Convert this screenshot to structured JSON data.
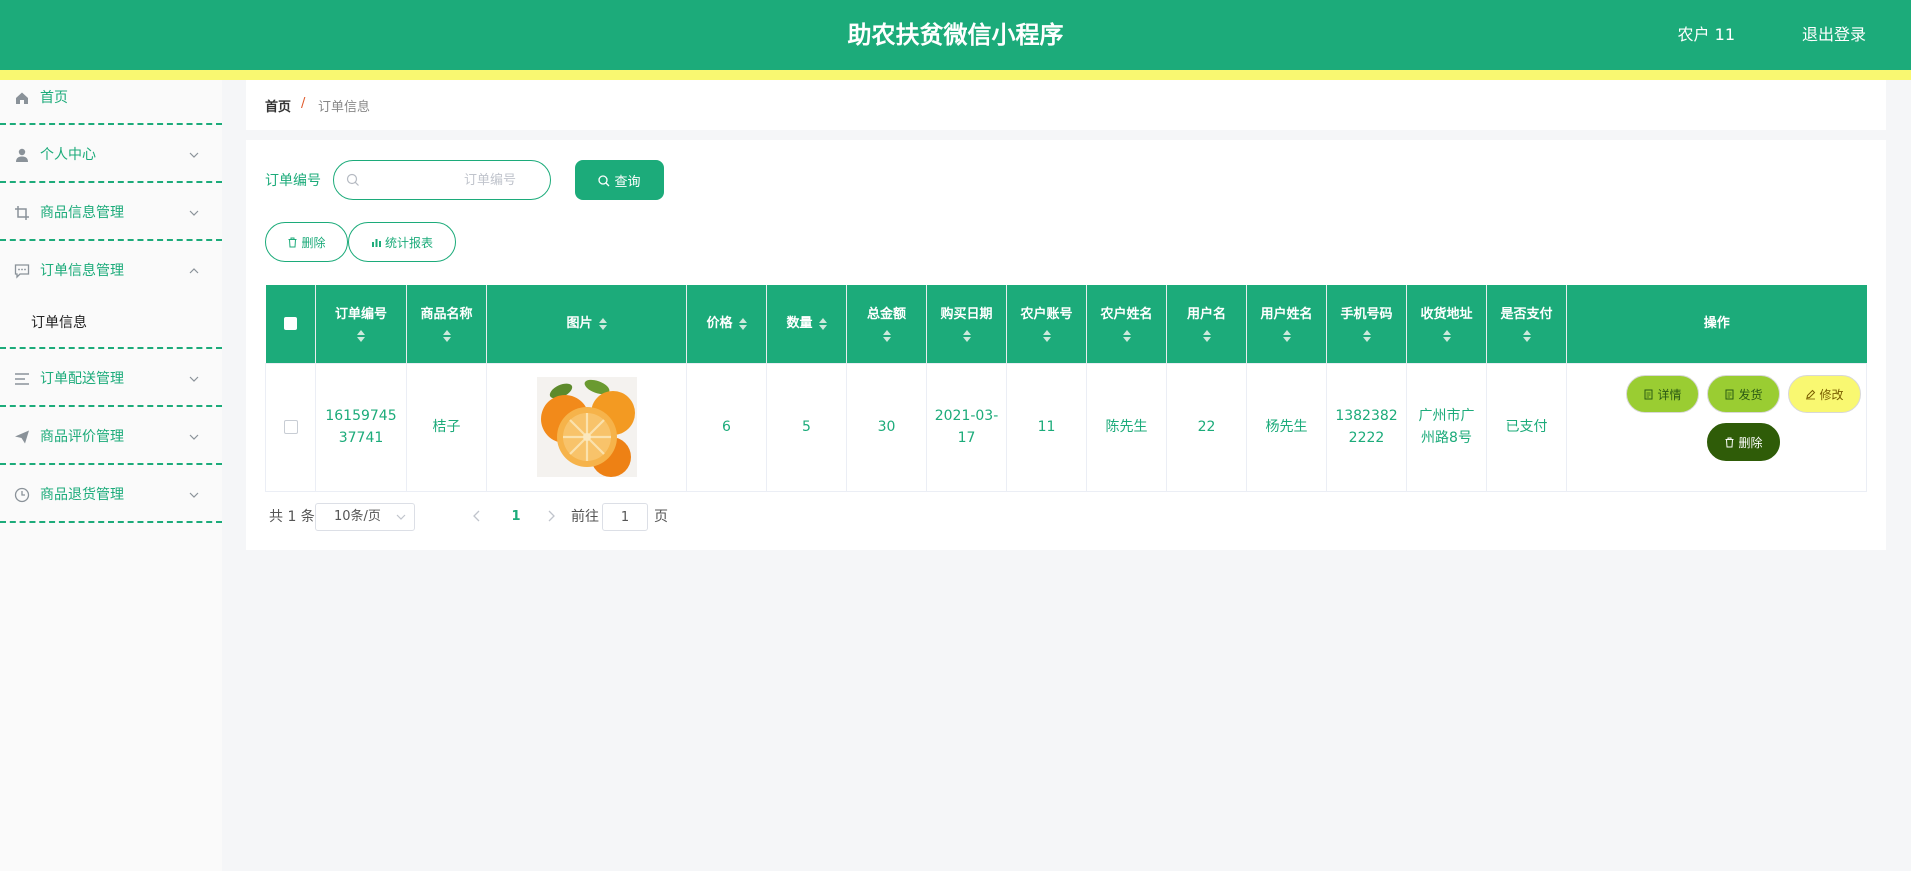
{
  "header": {
    "title": "助农扶贫微信小程序",
    "user": "农户 11",
    "logout": "退出登录",
    "colors": {
      "primary": "#1cab7a",
      "strip": "#f9f871"
    }
  },
  "sidebar": {
    "items": [
      {
        "label": "首页",
        "icon": "home-icon"
      },
      {
        "label": "个人中心",
        "icon": "user-icon"
      },
      {
        "label": "商品信息管理",
        "icon": "crop-icon"
      },
      {
        "label": "订单信息管理",
        "icon": "chat-icon",
        "sub": "订单信息"
      },
      {
        "label": "订单配送管理",
        "icon": "list-icon"
      },
      {
        "label": "商品评价管理",
        "icon": "send-icon"
      },
      {
        "label": "商品退货管理",
        "icon": "clock-icon"
      }
    ]
  },
  "breadcrumb": {
    "home": "首页",
    "separator": "/",
    "current": "订单信息"
  },
  "search": {
    "label": "订单编号",
    "placeholder": "订单编号",
    "value": "",
    "button": "查询"
  },
  "actions": {
    "delete": "删除",
    "report": "统计报表"
  },
  "table": {
    "headers": [
      "订单编号",
      "商品名称",
      "图片",
      "价格",
      "数量",
      "总金额",
      "购买日期",
      "农户账号",
      "农户姓名",
      "用户名",
      "用户姓名",
      "手机号码",
      "收货地址",
      "是否支付",
      "操作"
    ],
    "rows": [
      {
        "order_no": "1615974537741",
        "product": "桔子",
        "image": "tangerine-image",
        "price": "6",
        "quantity": "5",
        "total": "30",
        "date": "2021-03-17",
        "farmer_account": "11",
        "farmer_name": "陈先生",
        "username": "22",
        "user_fullname": "杨先生",
        "phone": "13823822222",
        "address": "广州市广州路8号",
        "paid": "已支付",
        "ops": {
          "detail": "详情",
          "ship": "发货",
          "edit": "修改",
          "delete": "删除"
        }
      }
    ]
  },
  "pagination": {
    "total": "共 1 条",
    "page_size": "10条/页",
    "current": "1",
    "goto_label": "前往",
    "goto_value": "1",
    "unit": "页"
  }
}
